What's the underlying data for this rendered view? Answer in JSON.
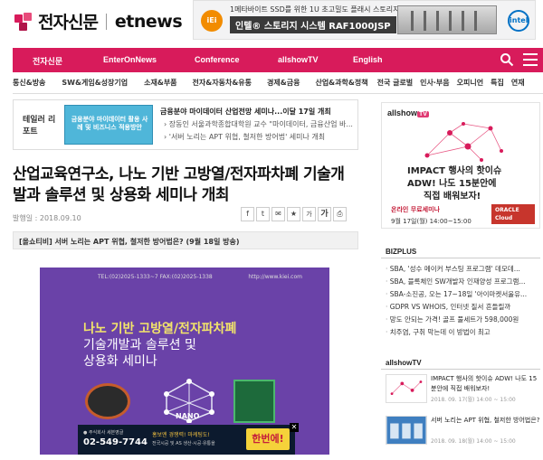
{
  "header": {
    "logo_ko": "전자신문",
    "logo_en": "etnews",
    "banner": {
      "brand": "iEi",
      "line1": "1메타바이트 SSD를 위한 1U 초고밀도 플래시 스토리지",
      "line2": "인텔® 스토리지 시스템 RAF1000JSP",
      "partner": "intel"
    }
  },
  "nav": {
    "items": [
      "전자신문",
      "EnterOnNews",
      "Conference",
      "allshowTV",
      "English"
    ],
    "accent": "#d81b5b"
  },
  "subnav": [
    "통신&방송",
    "SW&게임&성장기업",
    "소재&부품",
    "전자&자동차&유통",
    "경제&금융",
    "산업&과학&정책",
    "전국 글로벌",
    "인사·부음",
    "오피니언",
    "특집",
    "연재"
  ],
  "theme": {
    "label": "테일러 리포트",
    "thumb_text": "금융분야 마이데이터 활용 사례 및 비즈니스 적용방안",
    "lead": "금융분야 마이데이터 산업전망 세미나...이달 17일 개최",
    "links": [
      "장동인 서울과학종합대학원 교수 \"마이데이터, 금융산업 바...",
      "'서버 노리는 APT 위협, 철저한 방어법' 세미나 개최"
    ]
  },
  "article": {
    "headline": "산업교육연구소, 나노 기반 고방열/전자파차폐 기술개발과 솔루션 및 상용화 세미나 개최",
    "date": "발행일 : 2018.09.10",
    "related": "[올쇼티비] 서버 노리는 APT 위협, 철저한 방어법은? (9월 18일 방송)",
    "tool_labels": [
      "f",
      "t",
      "✉",
      "★",
      "가",
      "가",
      "⎙"
    ]
  },
  "inline_ad": {
    "contact": "TEL:(02)2025-1333~7    FAX:(02)2025-1338",
    "site": "http://www.kiei.com",
    "title1": "나노 기반 고방열/전자파차폐",
    "title2": "기술개발과 솔루션 및",
    "title3": "상용화 세미나",
    "nano": "NANO",
    "foot_company": "● 주식회사 세븐영글",
    "foot_phone": "02-549-7744",
    "foot_m1": "홍보엔 경쟁력! 마케팅도!",
    "foot_m2": "전국시공 및 AS 생산·시공·유통을",
    "foot_btn": "한번에!"
  },
  "side_ad": {
    "brand": "allshow",
    "brand_tag": "TV",
    "h1": "IMPACT 행사의 핫이슈",
    "h2": "ADW! 나도 15분안에",
    "h3": "직접 배워보자!",
    "cta": "온라인 무료세미나",
    "when": "9월 17일(월) 14:00~15:00",
    "partner": "ORACLE Cloud"
  },
  "bizplus": {
    "title": "BIZPLUS",
    "items": [
      "SBA, '성수 메이커 부스팅 프로그램' 데모데...",
      "SBA, 블록체인 SW개발자 인재양성 프로그램...",
      "SBA-소진공, 오는 17~18일 '아이마켓서울유...",
      "GDPR VS WHOIS, 인터넷 질서 흔들릴까",
      "망도 안되는 가격! 골프 풀세트가 598,000원",
      "치주염, 구취 막는데 이 방법이 최고"
    ]
  },
  "allshowtv": {
    "title": "allshowTV",
    "items": [
      {
        "text": "IMPACT 행사의 핫이슈 ADW! 나도 15분안에 직접 배워보자!",
        "date": "2018. 09. 17(월) 14:00 ~ 15:00"
      },
      {
        "text": "서버 노리는 APT 위협, 철저한 방어법은?",
        "date": "2018. 09. 18(월) 14:00 ~ 15:00"
      }
    ]
  }
}
